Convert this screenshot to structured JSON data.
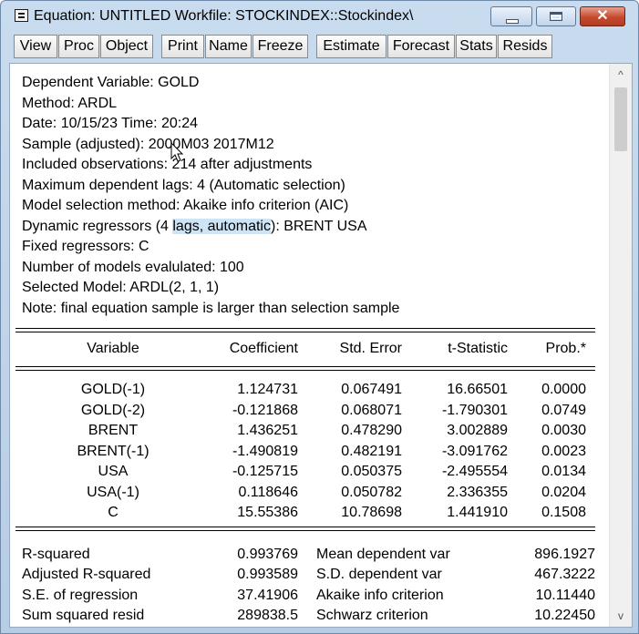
{
  "window": {
    "title": "Equation: UNTITLED   Workfile: STOCKINDEX::Stockindex\\",
    "close_glyph": "✕"
  },
  "toolbar": {
    "buttons": [
      "View",
      "Proc",
      "Object",
      "Print",
      "Name",
      "Freeze",
      "Estimate",
      "Forecast",
      "Stats",
      "Resids"
    ]
  },
  "header": {
    "lines": [
      "Dependent Variable: GOLD",
      "Method: ARDL",
      "Date: 10/15/23   Time: 20:24",
      "Sample (adjusted): 2000M03 2017M12",
      "Included observations: 214 after adjustments",
      "Maximum dependent lags: 4 (Automatic selection)",
      "Model selection method: Akaike info criterion (AIC)",
      "Dynamic regressors (4 lags, automatic): BRENT USA",
      "Fixed regressors: C",
      "Number of models evalulated: 100",
      "Selected Model: ARDL(2, 1, 1)",
      "Note: final equation sample is larger than selection sample"
    ],
    "dynamic_prefix": "Dynamic regressors (4 ",
    "dynamic_selected": "lags, automatic",
    "dynamic_suffix": "): BRENT USA"
  },
  "table": {
    "columns": [
      "Variable",
      "Coefficient",
      "Std. Error",
      "t-Statistic",
      "Prob.*"
    ],
    "rows": [
      [
        "GOLD(-1)",
        "1.124731",
        "0.067491",
        "16.66501",
        "0.0000"
      ],
      [
        "GOLD(-2)",
        "-0.121868",
        "0.068071",
        "-1.790301",
        "0.0749"
      ],
      [
        "BRENT",
        "1.436251",
        "0.478290",
        "3.002889",
        "0.0030"
      ],
      [
        "BRENT(-1)",
        "-1.490819",
        "0.482191",
        "-3.091762",
        "0.0023"
      ],
      [
        "USA",
        "-0.125715",
        "0.050375",
        "-2.495554",
        "0.0134"
      ],
      [
        "USA(-1)",
        "0.118646",
        "0.050782",
        "2.336355",
        "0.0204"
      ],
      [
        "C",
        "15.55386",
        "10.78698",
        "1.441910",
        "0.1508"
      ]
    ]
  },
  "stats": [
    [
      "R-squared",
      "0.993769",
      "Mean dependent var",
      "896.1927"
    ],
    [
      "Adjusted R-squared",
      "0.993589",
      "S.D. dependent var",
      "467.3222"
    ],
    [
      "S.E. of regression",
      "37.41906",
      "Akaike info criterion",
      "10.11440"
    ],
    [
      "Sum squared resid",
      "289838.5",
      "Schwarz criterion",
      "10.22450"
    ]
  ],
  "scrollbar": {
    "up_glyph": "^",
    "down_glyph": "v"
  }
}
